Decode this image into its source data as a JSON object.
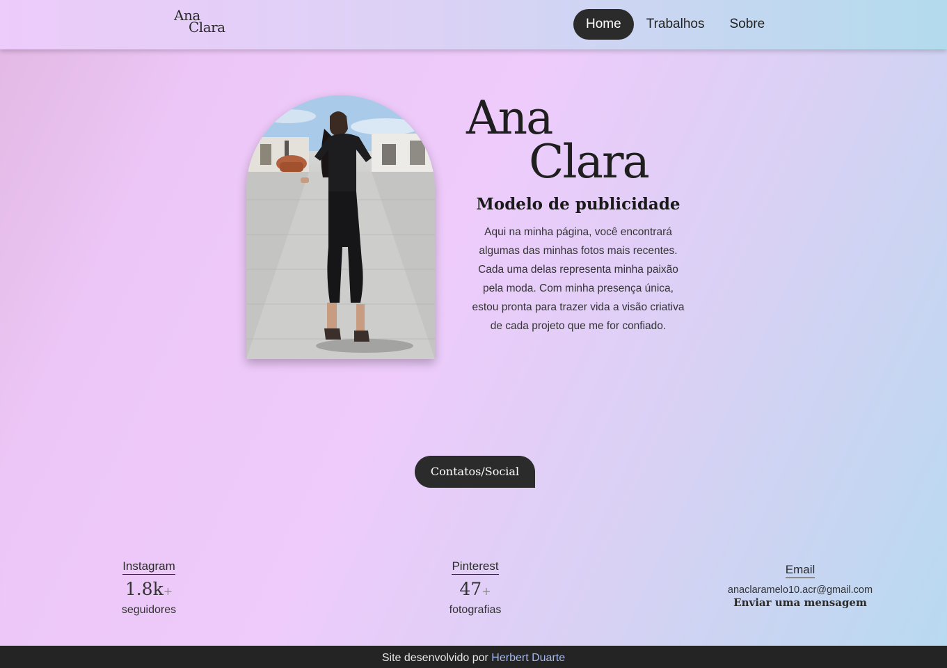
{
  "header": {
    "logo_line1": "Ana",
    "logo_line2": "Clara",
    "nav": [
      {
        "label": "Home",
        "active": true
      },
      {
        "label": "Trabalhos",
        "active": false
      },
      {
        "label": "Sobre",
        "active": false
      }
    ]
  },
  "hero": {
    "photo_alt": "Ana Clara photo",
    "name_line1": "Ana",
    "name_line2": "Clara",
    "subtitle": "Modelo de publicidade",
    "bio_lines": [
      "Aqui na minha página, você encontrará",
      "algumas das minhas fotos mais recentes.",
      "Cada uma delas representa minha paixão",
      "pela moda. Com minha presença única,",
      "estou pronta para trazer vida a visão criativa",
      "de cada projeto que me for confiado."
    ]
  },
  "contacts": {
    "button_label": "Contatos/Social",
    "instagram": {
      "label": "Instagram",
      "value": "1.8k",
      "plus": "+",
      "unit": "seguidores"
    },
    "pinterest": {
      "label": "Pinterest",
      "value": "47",
      "plus": "+",
      "unit": "fotografias"
    },
    "email": {
      "label": "Email",
      "address": "anaclaramelo10.acr@gmail.com",
      "send_label": "Enviar uma mensagem"
    }
  },
  "footer": {
    "text": "Site desenvolvido por ",
    "author": "Herbert Duarte"
  }
}
